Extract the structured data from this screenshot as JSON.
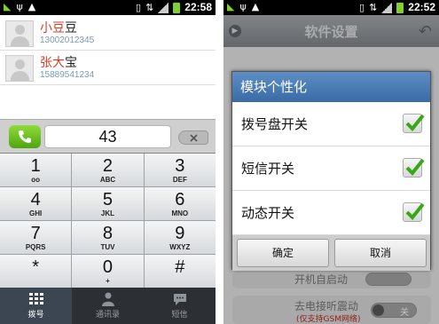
{
  "left_screen": {
    "status_bar": {
      "time": "22:58"
    },
    "contacts": [
      {
        "name_highlight": "小豆",
        "name_rest": "豆",
        "phone": "13002012345"
      },
      {
        "name_highlight": "张大",
        "name_rest": "宝",
        "phone": "15889541234"
      }
    ],
    "dial_input": {
      "value": "43"
    },
    "keypad": [
      {
        "digit": "1",
        "letters": "oo"
      },
      {
        "digit": "2",
        "letters": "ABC"
      },
      {
        "digit": "3",
        "letters": "DEF"
      },
      {
        "digit": "4",
        "letters": "GHI"
      },
      {
        "digit": "5",
        "letters": "JKL"
      },
      {
        "digit": "6",
        "letters": "MNO"
      },
      {
        "digit": "7",
        "letters": "PQRS"
      },
      {
        "digit": "8",
        "letters": "TUV"
      },
      {
        "digit": "9",
        "letters": "WXYZ"
      },
      {
        "digit": "*",
        "letters": ""
      },
      {
        "digit": "0",
        "letters": "+"
      },
      {
        "digit": "#",
        "letters": ""
      }
    ],
    "tabs": [
      {
        "label": "拨号",
        "icon": "dialpad-icon",
        "active": true
      },
      {
        "label": "通讯录",
        "icon": "person-icon",
        "active": false
      },
      {
        "label": "短信",
        "icon": "message-icon",
        "active": false
      }
    ]
  },
  "right_screen": {
    "status_bar": {
      "time": "22:52"
    },
    "title": "软件设置",
    "background_rows": {
      "row1_label": "开机自启动",
      "row2_label": "去电接听震动",
      "row2_note": "(仅支持GSM网络)",
      "toggle_text": "关"
    },
    "dialog": {
      "title": "模块个性化",
      "options": [
        {
          "label": "拨号盘开关",
          "checked": true
        },
        {
          "label": "短信开关",
          "checked": true
        },
        {
          "label": "动态开关",
          "checked": true
        }
      ],
      "confirm_label": "确定",
      "cancel_label": "取消"
    }
  },
  "colors": {
    "highlight_red": "#e03a1e",
    "check_green": "#38a814",
    "dialog_title_blue": "#4a7db8"
  }
}
